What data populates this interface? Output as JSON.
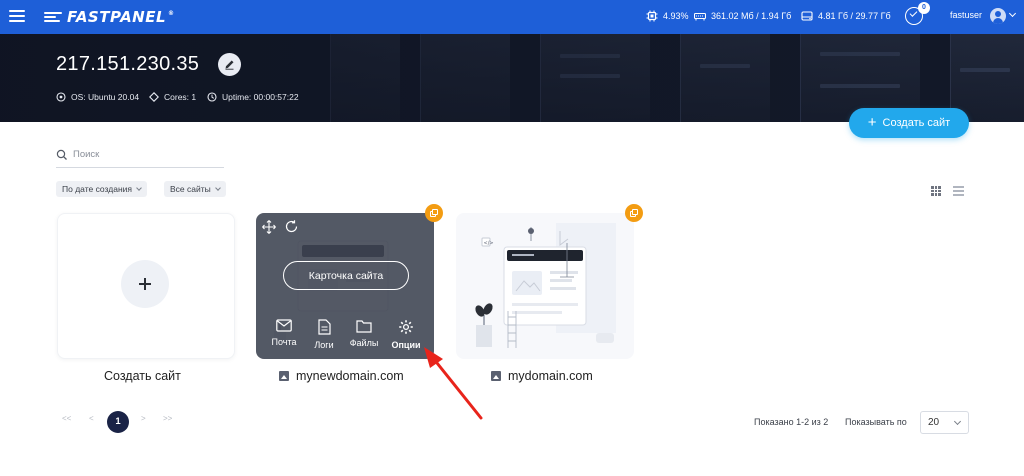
{
  "topbar": {
    "logo": "FASTPANEL",
    "logo_reg": "®",
    "cpu": "4.93%",
    "ram": "361.02 Мб / 1.94 Гб",
    "disk": "4.81 Гб / 29.77 Гб",
    "notifications": "0",
    "username": "fastuser"
  },
  "server": {
    "ip": "217.151.230.35",
    "os": "OS: Ubuntu 20.04",
    "cores": "Cores: 1",
    "uptime": "Uptime: 00:00:57:22"
  },
  "actions": {
    "create_site": "Создать сайт"
  },
  "search": {
    "placeholder": "Поиск"
  },
  "filters": {
    "sort": "По дате создания",
    "scope": "Все сайты"
  },
  "cards": {
    "add_label": "Создать сайт",
    "site1": {
      "name": "mynewdomain.com",
      "card_button": "Карточка сайта",
      "actions": [
        "Почта",
        "Логи",
        "Файлы",
        "Опции"
      ]
    },
    "site2": {
      "name": "mydomain.com"
    }
  },
  "pagination": {
    "first": "<<",
    "prev": "<",
    "current": "1",
    "next": ">",
    "last": ">>",
    "shown": "Показано 1-2 из 2",
    "per_page_label": "Показывать по",
    "per_page": "20"
  },
  "colors": {
    "topbar": "#1e5fd8",
    "accent": "#22a8ec",
    "badge": "#f39c12",
    "arrow": "#e8241b",
    "pagination_active": "#1a2346"
  }
}
